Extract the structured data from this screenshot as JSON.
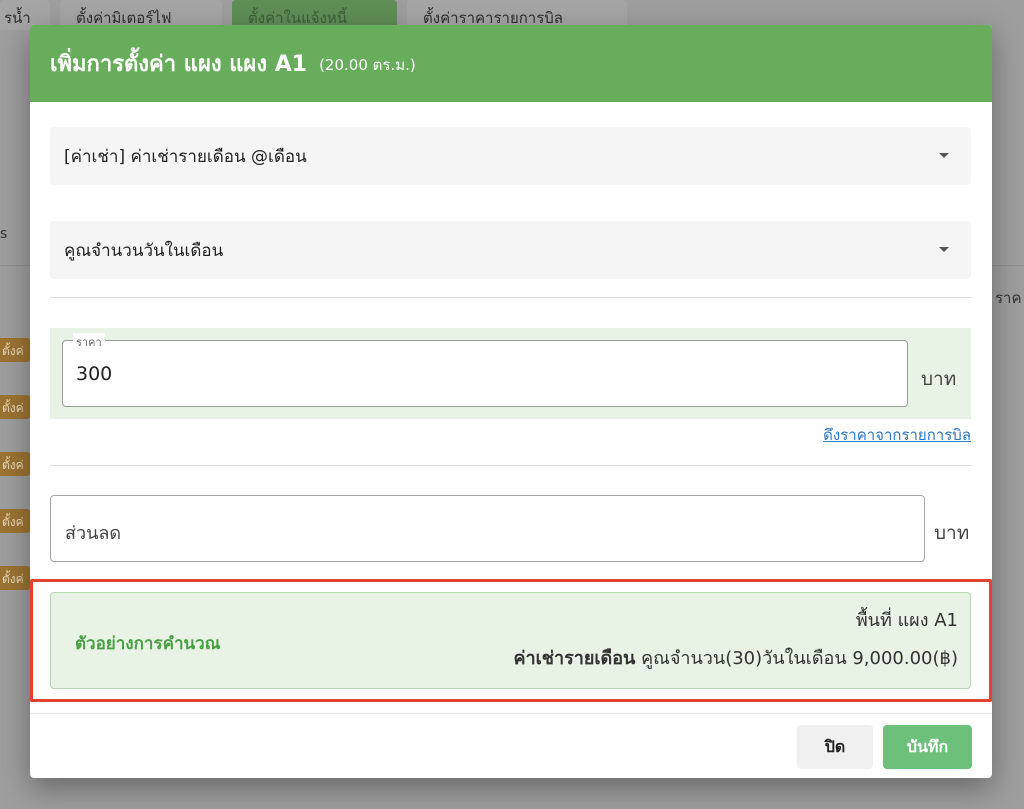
{
  "background": {
    "tabs": [
      "รน้ำ",
      "ตั้งค่ามิเตอร์ไฟ",
      "ตั้งค่าในแจ้งหนี้",
      "ตั้งค่าราคารายการบิล"
    ],
    "left_letter": "s",
    "right_text": "ราค",
    "chip_label": "ตั้งค่"
  },
  "dialog": {
    "title": "เพิ่มการตั้งค่า แผง แผง A1",
    "subtitle": "(20.00 ตร.ม.)",
    "fee_select": "[ค่าเช่า] ค่าเช่ารายเดือน @เดือน",
    "multiplier_select": "คูณจำนวนวันในเดือน",
    "price": {
      "label": "ราคา",
      "value": "300",
      "unit": "บาท"
    },
    "pull_price_link": "ดึงราคาจากรายการบิล",
    "discount": {
      "placeholder": "ส่วนลด",
      "unit": "บาท"
    },
    "calculation": {
      "label": "ตัวอย่างการคำนวณ",
      "area_line": "พื้นที่ แผง A1",
      "fee_name": "ค่าเช่ารายเดือน",
      "formula": "คูณจำนวน(30)วันในเดือน 9,000.00(฿)"
    },
    "buttons": {
      "close": "ปิด",
      "save": "บันทึก"
    }
  },
  "colors": {
    "header": "#67ad5b",
    "save_button": "#6cc07a",
    "highlight": "#e0432f",
    "link": "#2b78c2"
  }
}
